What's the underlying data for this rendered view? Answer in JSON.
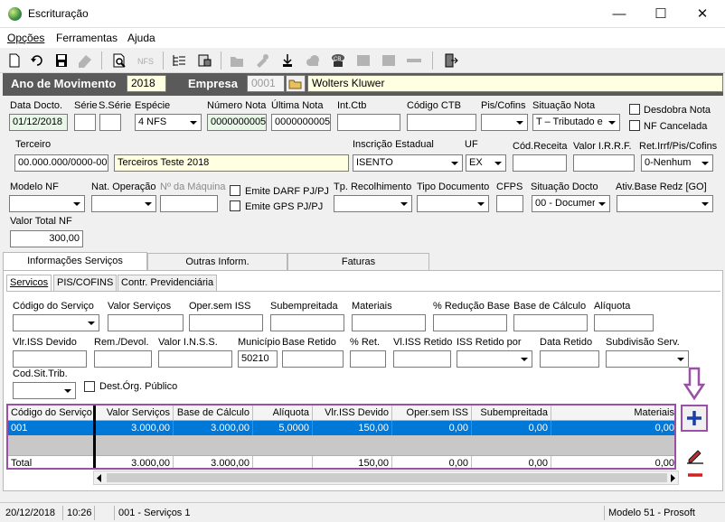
{
  "window": {
    "title": "Escrituração",
    "min": "—",
    "max": "☐",
    "close": "✕"
  },
  "menu": [
    "Opções",
    "Ferramentas",
    "Ajuda"
  ],
  "band": {
    "ano_label": "Ano de Movimento",
    "ano_value": "2018",
    "empresa_label": "Empresa",
    "empresa_code": "0001",
    "empresa_name": "Wolters Kluwer"
  },
  "row1": {
    "data_docto_label": "Data Docto.",
    "data_docto": "01/12/2018",
    "serie_label": "Série",
    "serie": "",
    "sserie_label": "S.Série",
    "sserie": "",
    "especie_label": "Espécie",
    "especie": "4 NFS",
    "numero_nota_label": "Número Nota",
    "numero_nota": "0000000005",
    "ultima_nota_label": "Última Nota",
    "ultima_nota": "0000000005",
    "int_ctb_label": "Int.Ctb",
    "int_ctb": "",
    "codigo_ctb_label": "Código CTB",
    "codigo_ctb": "",
    "pis_cofins_label": "Pis/Cofins",
    "pis_cofins": "",
    "situacao_nota_label": "Situação Nota",
    "situacao_nota": "T – Tributado e",
    "desdobra_label": "Desdobra Nota",
    "nf_cancelada_label": "NF Cancelada"
  },
  "row2": {
    "terceiro_label": "Terceiro",
    "terceiro_code": "00.000.000/0000-00",
    "terceiro_name": "Terceiros Teste 2018",
    "ie_label": "Inscrição Estadual",
    "ie": "ISENTO",
    "uf_label": "UF",
    "uf": "EX",
    "cod_receita_label": "Cód.Receita",
    "cod_receita": "",
    "valor_irrf_label": "Valor I.R.R.F.",
    "valor_irrf": "",
    "ret_label": "Ret.Irrf/Pis/Cofins",
    "ret": "0-Nenhum"
  },
  "row3": {
    "modelo_nf_label": "Modelo NF",
    "nat_operacao_label": "Nat. Operação",
    "num_maquina_label": "Nº da Máquina",
    "emite_darf_label": "Emite DARF PJ/PJ",
    "emite_gps_label": "Emite GPS PJ/PJ",
    "tp_recolhimento_label": "Tp. Recolhimento",
    "tipo_documento_label": "Tipo Documento",
    "cfps_label": "CFPS",
    "situacao_docto_label": "Situação Docto",
    "situacao_docto": "00 - Documer",
    "ativ_base_label": "Ativ.Base Redz [GO]"
  },
  "valor_total": {
    "label": "Valor Total NF",
    "value": "300,00"
  },
  "tabs": [
    "Informações Serviços",
    "Outras Inform.",
    "Faturas"
  ],
  "subtabs": [
    "Servicos",
    "PIS/COFINS",
    "Contr. Previdenciária"
  ],
  "svc1": {
    "codigo_servico": "Código do Serviço",
    "valor_servicos": "Valor Serviços",
    "oper_sem_iss": "Oper.sem ISS",
    "subempreitada": "Subempreitada",
    "materiais": "Materiais",
    "reducao": "% Redução Base",
    "base_calculo": "Base de Cálculo",
    "aliquota": "Alíquota"
  },
  "svc2": {
    "vlr_iss_devido": "Vlr.ISS Devido",
    "rem_devol": "Rem./Devol.",
    "valor_inss": "Valor I.N.S.S.",
    "municipio": "Município",
    "municipio_value": "50210",
    "base_retido": "Base Retido",
    "pct_ret": "% Ret.",
    "vl_iss_retido": "Vl.ISS Retido",
    "iss_retido_por": "ISS Retido por",
    "data_retido": "Data Retido",
    "subdivisao": "Subdivisão Serv."
  },
  "svc3": {
    "cod_sit_trib": "Cod.Sit.Trib.",
    "dest_org": "Dest.Órg. Público"
  },
  "grid": {
    "headers": [
      "Código do Serviço",
      "Valor Serviços",
      "Base de Cálculo",
      "Alíquota",
      "Vlr.ISS Devido",
      "Oper.sem ISS",
      "Subempreitada",
      "Materiais"
    ],
    "row": [
      "001",
      "3.000,00",
      "3.000,00",
      "5,0000",
      "150,00",
      "0,00",
      "0,00",
      "0,00"
    ],
    "total": [
      "Total",
      "3.000,00",
      "3.000,00",
      "",
      "150,00",
      "0,00",
      "0,00",
      "0,00"
    ]
  },
  "status": {
    "date": "20/12/2018",
    "time": "10:26",
    "service": "001 - Serviços 1",
    "model": "Modelo 51 - Prosoft"
  },
  "colors": {
    "band": "#5a5a5a",
    "selection": "#0078d7",
    "highlight": "#9b4fa8",
    "add": "#1a3fa8",
    "remove": "#d42020"
  }
}
